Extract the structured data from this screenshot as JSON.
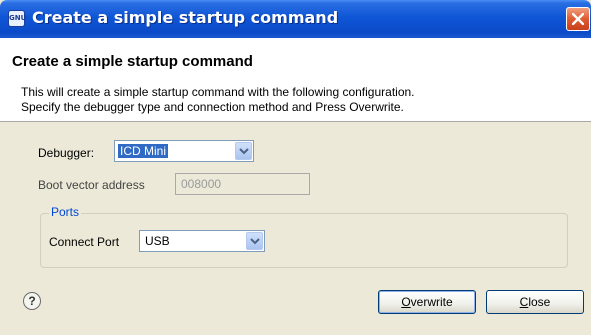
{
  "window": {
    "title": "Create a simple startup command",
    "icon_label": "GNU"
  },
  "header": {
    "title": "Create a simple startup command",
    "description_lines": [
      "This will create a simple startup command with the following configuration.",
      "Specify the debugger type and connection method and Press Overwrite."
    ]
  },
  "form": {
    "debugger": {
      "label": "Debugger:",
      "value": "ICD Mini"
    },
    "boot_vector": {
      "label": "Boot vector address",
      "value": "008000"
    },
    "ports_group": {
      "legend": "Ports",
      "connect_port": {
        "label": "Connect Port",
        "value": "USB"
      }
    }
  },
  "footer": {
    "help_icon": "help-icon",
    "overwrite": {
      "mnemonic": "O",
      "rest": "verwrite"
    },
    "close": {
      "mnemonic": "C",
      "rest": "lose"
    }
  },
  "colors": {
    "titlebar": "#0b4ac8",
    "close_button": "#e05a30",
    "selection": "#316ac5",
    "group_legend": "#0046d5",
    "dialog_bg": "#ece9d8"
  }
}
